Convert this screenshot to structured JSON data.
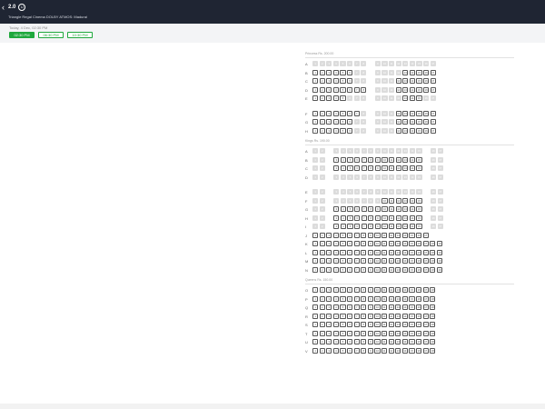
{
  "header": {
    "back_icon": "chevron-left-icon",
    "movie_title": "2.0",
    "rating": "U",
    "venue": "Triangle Regal Cinema DOLBY ATMOS: Madurai"
  },
  "showtimes": {
    "date_label": "Today, 4 Dec, 02:30 PM",
    "items": [
      {
        "label": "02:30 PM",
        "active": true
      },
      {
        "label": "06:30 PM",
        "active": false
      },
      {
        "label": "10:30 PM",
        "active": false
      }
    ]
  },
  "seat_sections": [
    {
      "name": "Princess Rs. 200.00",
      "rows": [
        {
          "label": "A",
          "groups": [
            [
              1,
              8
            ],
            [
              9,
              17
            ]
          ],
          "sold": "all"
        },
        {
          "label": "B",
          "groups": [
            [
              1,
              8
            ],
            [
              9,
              17
            ]
          ],
          "sold": [
            7,
            8,
            9,
            10,
            11,
            12
          ]
        },
        {
          "label": "C",
          "groups": [
            [
              1,
              8
            ],
            [
              9,
              17
            ]
          ],
          "sold": [
            7,
            8,
            9,
            10,
            11
          ]
        },
        {
          "label": "D",
          "groups": [
            [
              1,
              8
            ],
            [
              9,
              17
            ]
          ],
          "sold": [
            9,
            10,
            11
          ]
        },
        {
          "label": "E",
          "groups": [
            [
              1,
              8
            ],
            [
              9,
              17
            ]
          ],
          "sold": [
            6,
            7,
            8,
            9,
            10,
            11,
            12,
            16,
            17
          ]
        },
        {
          "gap": true
        },
        {
          "label": "F",
          "groups": [
            [
              1,
              8
            ],
            [
              9,
              17
            ]
          ],
          "sold": [
            8,
            9,
            10,
            11
          ]
        },
        {
          "label": "G",
          "groups": [
            [
              1,
              8
            ],
            [
              9,
              17
            ]
          ],
          "sold": [
            7,
            8,
            9,
            10,
            11
          ]
        },
        {
          "label": "H",
          "groups": [
            [
              1,
              8
            ],
            [
              9,
              17
            ]
          ],
          "sold": [
            7,
            8,
            9,
            10,
            11
          ]
        }
      ]
    },
    {
      "name": "Kings Rs. 190.00",
      "rows": [
        {
          "label": "A",
          "groups": [
            [
              1,
              2
            ],
            [
              3,
              15
            ],
            [
              16,
              17
            ]
          ],
          "sold": [
            1,
            2,
            3,
            4,
            5,
            6,
            7,
            8,
            9,
            10,
            11,
            12,
            13,
            14,
            15,
            16,
            17
          ]
        },
        {
          "label": "B",
          "groups": [
            [
              1,
              2
            ],
            [
              3,
              15
            ],
            [
              16,
              17
            ]
          ],
          "sold": [
            1,
            2,
            16,
            17
          ]
        },
        {
          "label": "C",
          "groups": [
            [
              1,
              2
            ],
            [
              3,
              15
            ],
            [
              16,
              17
            ]
          ],
          "sold": [
            1,
            2,
            16,
            17
          ]
        },
        {
          "label": "D",
          "groups": [
            [
              1,
              2
            ],
            [
              3,
              15
            ],
            [
              16,
              17
            ]
          ],
          "sold": [
            1,
            2,
            3,
            4,
            5,
            6,
            7,
            8,
            9,
            10,
            11,
            12,
            13,
            14,
            15,
            16,
            17
          ]
        },
        {
          "gap": true
        },
        {
          "label": "E",
          "groups": [
            [
              1,
              2
            ],
            [
              3,
              15
            ],
            [
              16,
              17
            ]
          ],
          "sold": [
            1,
            2,
            3,
            4,
            5,
            6,
            7,
            8,
            9,
            10,
            11,
            12,
            13,
            14,
            15,
            16,
            17
          ]
        },
        {
          "label": "F",
          "groups": [
            [
              1,
              2
            ],
            [
              3,
              15
            ],
            [
              16,
              17
            ]
          ],
          "sold": [
            1,
            2,
            3,
            4,
            5,
            6,
            7,
            8,
            9,
            16,
            17
          ]
        },
        {
          "label": "G",
          "groups": [
            [
              1,
              2
            ],
            [
              3,
              15
            ],
            [
              16,
              17
            ]
          ],
          "sold": [
            1,
            2,
            16,
            17
          ]
        },
        {
          "label": "H",
          "groups": [
            [
              1,
              2
            ],
            [
              3,
              15
            ],
            [
              16,
              17
            ]
          ],
          "sold": [
            1,
            2,
            16,
            17
          ]
        },
        {
          "label": "I",
          "groups": [
            [
              1,
              2
            ],
            [
              3,
              15
            ],
            [
              16,
              17
            ]
          ],
          "sold": [
            1,
            2,
            16,
            17
          ]
        },
        {
          "label": "J",
          "groups": [
            [
              1,
              17
            ]
          ],
          "sold": []
        },
        {
          "label": "K",
          "groups": [
            [
              1,
              19
            ]
          ],
          "sold": []
        },
        {
          "label": "L",
          "groups": [
            [
              1,
              19
            ]
          ],
          "sold": []
        },
        {
          "label": "M",
          "groups": [
            [
              1,
              19
            ]
          ],
          "sold": []
        },
        {
          "label": "N",
          "groups": [
            [
              1,
              19
            ]
          ],
          "sold": []
        }
      ]
    },
    {
      "name": "Queens Rs. 150.00",
      "rows": [
        {
          "label": "O",
          "groups": [
            [
              1,
              18
            ]
          ],
          "sold": []
        },
        {
          "label": "P",
          "groups": [
            [
              1,
              18
            ]
          ],
          "sold": []
        },
        {
          "label": "Q",
          "groups": [
            [
              1,
              18
            ]
          ],
          "sold": []
        },
        {
          "label": "R",
          "groups": [
            [
              1,
              18
            ]
          ],
          "sold": []
        },
        {
          "label": "S",
          "groups": [
            [
              1,
              18
            ]
          ],
          "sold": []
        },
        {
          "label": "T",
          "groups": [
            [
              1,
              18
            ]
          ],
          "sold": []
        },
        {
          "label": "U",
          "groups": [
            [
              1,
              18
            ]
          ],
          "sold": []
        },
        {
          "label": "V",
          "groups": [
            [
              1,
              18
            ]
          ],
          "sold": []
        }
      ]
    }
  ]
}
